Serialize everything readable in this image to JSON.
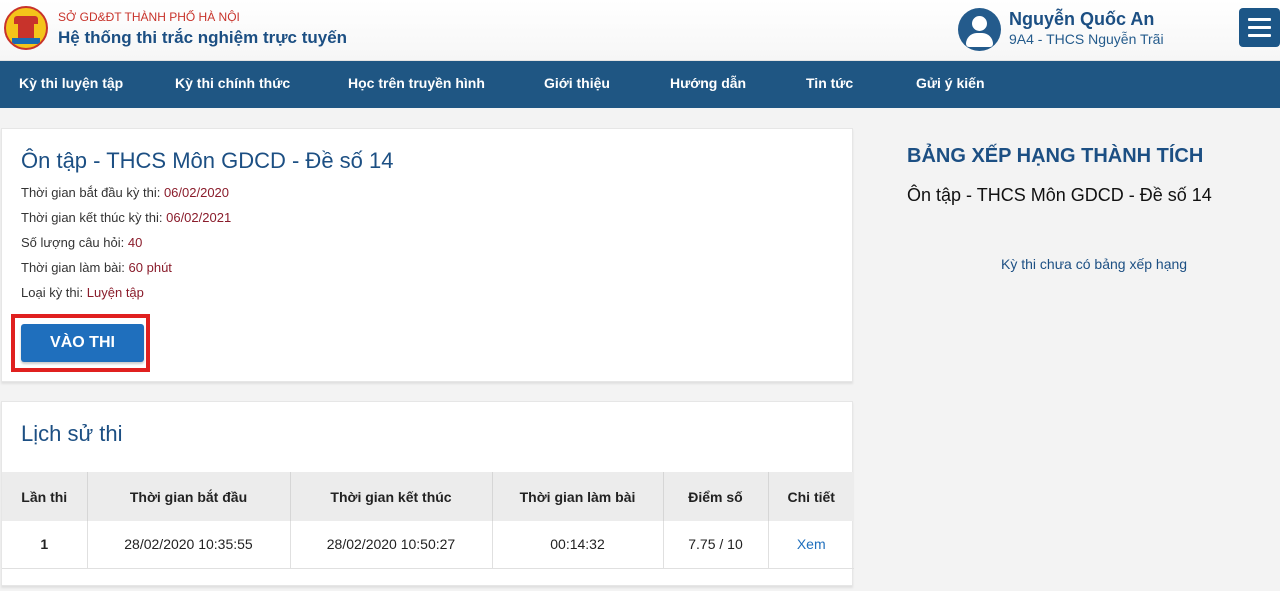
{
  "header": {
    "org_name": "SỞ GD&ĐT THÀNH PHỐ HÀ NỘI",
    "system_name": "Hệ thống thi trắc nghiệm trực tuyến",
    "user_name": "Nguyễn Quốc An",
    "user_class": "9A4 - THCS Nguyễn Trãi"
  },
  "nav": {
    "items": [
      {
        "label": "Kỳ thi luyện tập"
      },
      {
        "label": "Kỳ thi chính thức"
      },
      {
        "label": "Học trên truyền hình"
      },
      {
        "label": "Giới thiệu"
      },
      {
        "label": "Hướng dẫn"
      },
      {
        "label": "Tin tức"
      },
      {
        "label": "Gửi ý kiến"
      }
    ]
  },
  "exam": {
    "title": "Ôn tập - THCS Môn GDCD - Đề số 14",
    "start_label": "Thời gian bắt đầu kỳ thi:",
    "start_value": "06/02/2020",
    "end_label": "Thời gian kết thúc kỳ thi:",
    "end_value": "06/02/2021",
    "questions_label": "Số lượng câu hỏi:",
    "questions_value": "40",
    "duration_label": "Thời gian làm bài:",
    "duration_value": "60 phút",
    "type_label": "Loại kỳ thi:",
    "type_value": "Luyện tập",
    "start_button": "VÀO THI"
  },
  "history": {
    "title": "Lịch sử thi",
    "columns": [
      "Lần thi",
      "Thời gian bắt đầu",
      "Thời gian kết thúc",
      "Thời gian làm bài",
      "Điểm số",
      "Chi tiết"
    ],
    "rows": [
      {
        "attempt": "1",
        "start": "28/02/2020 10:35:55",
        "end": "28/02/2020 10:50:27",
        "duration": "00:14:32",
        "score": "7.75 / 10",
        "detail": "Xem"
      }
    ]
  },
  "ranking": {
    "title": "BẢNG XẾP HẠNG THÀNH TÍCH",
    "exam_name": "Ôn tập - THCS Môn GDCD - Đề số 14",
    "empty_text": "Kỳ thi chưa có bảng xếp hạng"
  },
  "colors": {
    "nav_bg": "#1f5683",
    "primary_button": "#1f6fbd",
    "highlight": "#e0201f",
    "value_text": "#8a1c2b"
  }
}
